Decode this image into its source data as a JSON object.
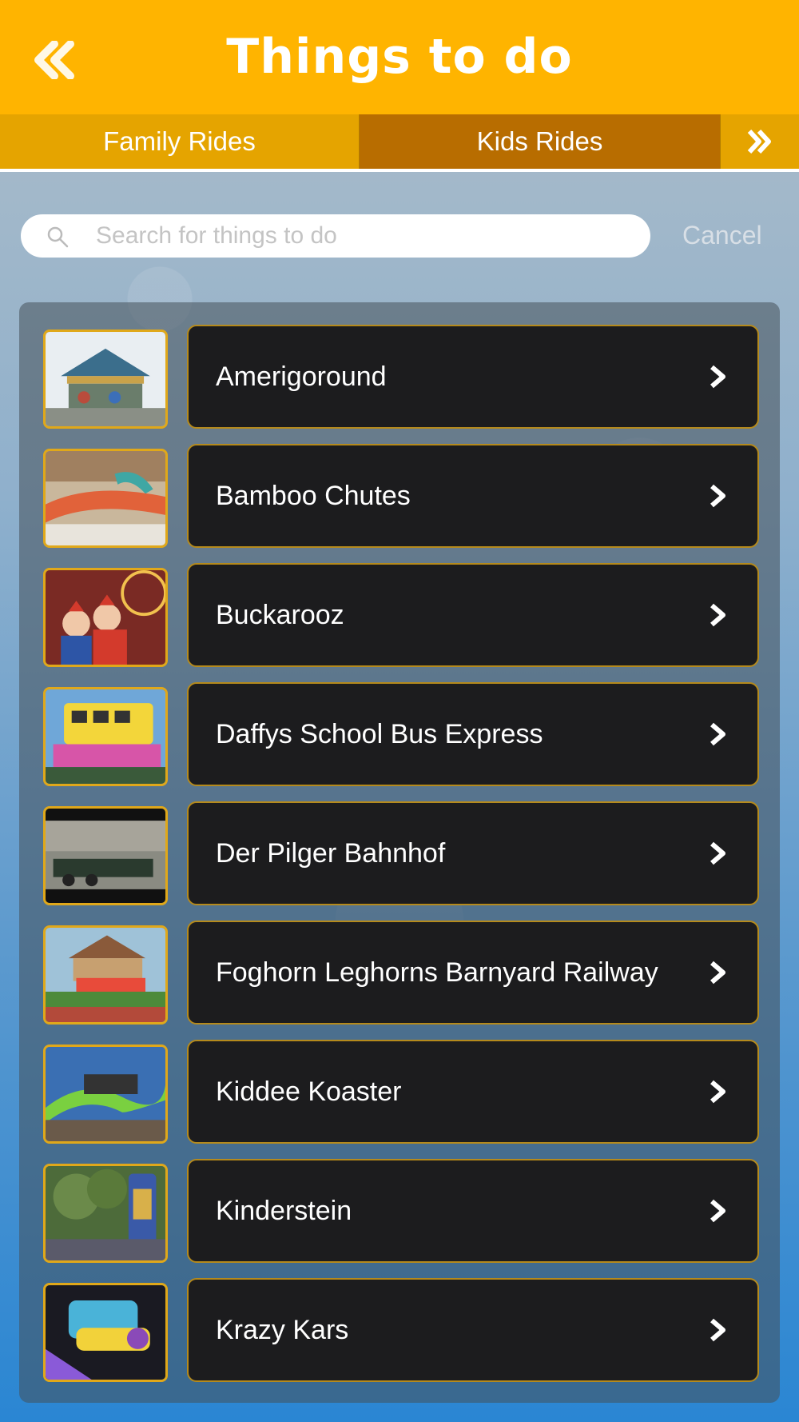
{
  "header": {
    "title": "Things to do",
    "back_icon": "double-chevron-left-icon"
  },
  "tabs": [
    {
      "label": "Family Rides",
      "selected": false
    },
    {
      "label": "Kids Rides",
      "selected": true
    },
    {
      "label": "",
      "icon": "double-chevron-right-icon"
    }
  ],
  "search": {
    "placeholder": "Search for things to do",
    "value": "",
    "cancel_label": "Cancel"
  },
  "colors": {
    "header": "#ffb400",
    "tab_selected": "#b86d00",
    "tab_default": "#e5a400",
    "row_background": "#1c1c1e",
    "row_border": "#b58a1c"
  },
  "items": [
    {
      "label": "Amerigoround",
      "thumb": "carousel"
    },
    {
      "label": "Bamboo Chutes",
      "thumb": "slide"
    },
    {
      "label": "Buckarooz",
      "thumb": "family"
    },
    {
      "label": "Daffys School Bus Express",
      "thumb": "bus"
    },
    {
      "label": "Der Pilger Bahnhof",
      "thumb": "train"
    },
    {
      "label": "Foghorn Leghorns Barnyard Railway",
      "thumb": "railway"
    },
    {
      "label": "Kiddee Koaster",
      "thumb": "coaster"
    },
    {
      "label": "Kinderstein",
      "thumb": "trees"
    },
    {
      "label": "Krazy Kars",
      "thumb": "cars"
    }
  ]
}
